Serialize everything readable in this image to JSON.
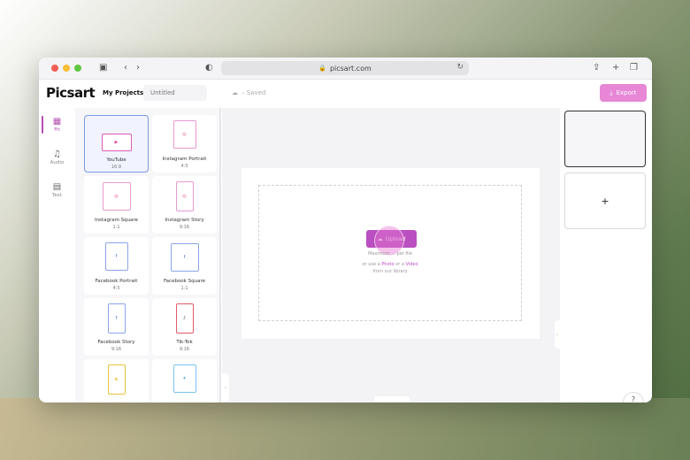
{
  "browser": {
    "url": "picsart.com"
  },
  "header": {
    "logo": "Picsart",
    "my_projects": "My Projects",
    "title_placeholder": "Untitled",
    "saved": "– Saved",
    "export_label": "Export"
  },
  "sidebar": {
    "items": [
      {
        "label": "Fit",
        "icon": "image-icon"
      },
      {
        "label": "Audio",
        "icon": "music-note-icon"
      },
      {
        "label": "Text",
        "icon": "text-icon"
      }
    ]
  },
  "templates": [
    {
      "name": "YouTube",
      "ratio": "16:9",
      "icon": "youtube-icon",
      "color": "#e0458f"
    },
    {
      "name": "Instagram Portrait",
      "ratio": "4:5",
      "icon": "instagram-icon",
      "color": "#e0458f"
    },
    {
      "name": "Instagram Square",
      "ratio": "1:1",
      "icon": "instagram-icon",
      "color": "#e0458f"
    },
    {
      "name": "Instagram Story",
      "ratio": "9:16",
      "icon": "instagram-icon",
      "color": "#e0458f"
    },
    {
      "name": "Facebook Portrait",
      "ratio": "4:5",
      "icon": "facebook-icon",
      "color": "#3b66d6"
    },
    {
      "name": "Facebook Square",
      "ratio": "1:1",
      "icon": "facebook-icon",
      "color": "#3b66d6"
    },
    {
      "name": "Facebook Story",
      "ratio": "9:16",
      "icon": "facebook-icon",
      "color": "#3b66d6"
    },
    {
      "name": "Tik-Tok",
      "ratio": "9:16",
      "icon": "tiktok-icon",
      "color": "#111111"
    },
    {
      "name": "",
      "ratio": "",
      "icon": "snapchat-icon",
      "color": "#e6c23a"
    },
    {
      "name": "",
      "ratio": "",
      "icon": "twitter-icon",
      "color": "#3aa0e6"
    }
  ],
  "canvas": {
    "upload_label": "Upload",
    "hint": "Maximum ... per file",
    "or_text_prefix": "or use a ",
    "photo_link": "Photo",
    "or_text_mid": " or a ",
    "video_link": "Video",
    "from_library": "from our library"
  },
  "pages": {
    "add_label": "+"
  },
  "colors": {
    "accent": "#e787d6",
    "upload": "#b94fc0",
    "selected_border": "#7a9be3"
  }
}
